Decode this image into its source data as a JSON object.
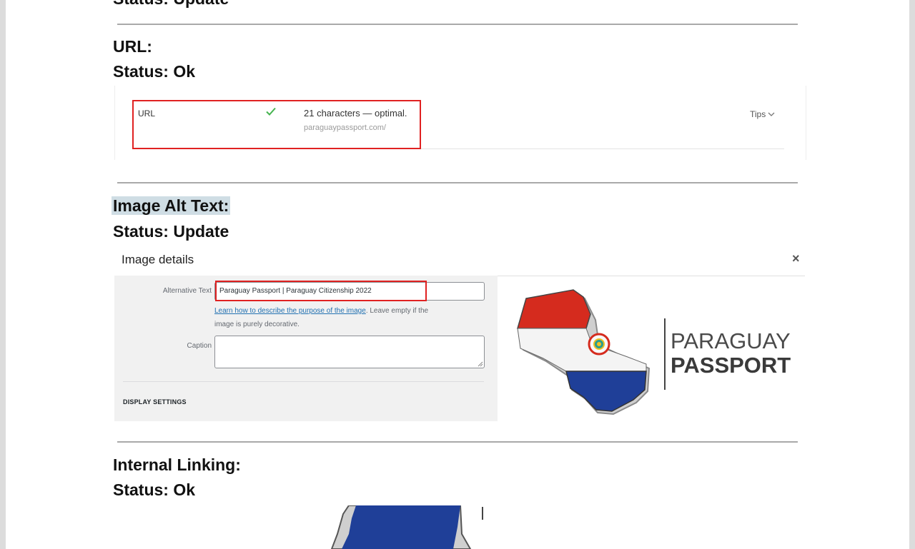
{
  "prev_section": {
    "status": "Status: Update"
  },
  "url_section": {
    "heading": "URL:",
    "status": "Status: Ok",
    "panel": {
      "label": "URL",
      "check_color": "#46b450",
      "result": "21 characters — optimal.",
      "value": "paraguaypassport.com/",
      "tips": "Tips"
    }
  },
  "alt_section": {
    "heading": "Image Alt Text:",
    "status": "Status: Update",
    "image_details": {
      "title": "Image details",
      "close": "×",
      "alt_label": "Alternative Text",
      "alt_value": "Paraguay Passport | Paraguay Citizenship 2022",
      "help_link": "Learn how to describe the purpose of the image",
      "help_rest": ". Leave empty if the",
      "help_line2": "image is purely decorative.",
      "caption_label": "Caption",
      "display_settings": "DISPLAY SETTINGS",
      "logo_line1": "PARAGUAY",
      "logo_line2": "PASSPORT"
    }
  },
  "internal_section": {
    "heading": "Internal Linking:",
    "status": "Status: Ok"
  },
  "colors": {
    "flag_red": "#d52b1e",
    "flag_blue": "#1f3f98",
    "highlight_red": "#e02121"
  }
}
